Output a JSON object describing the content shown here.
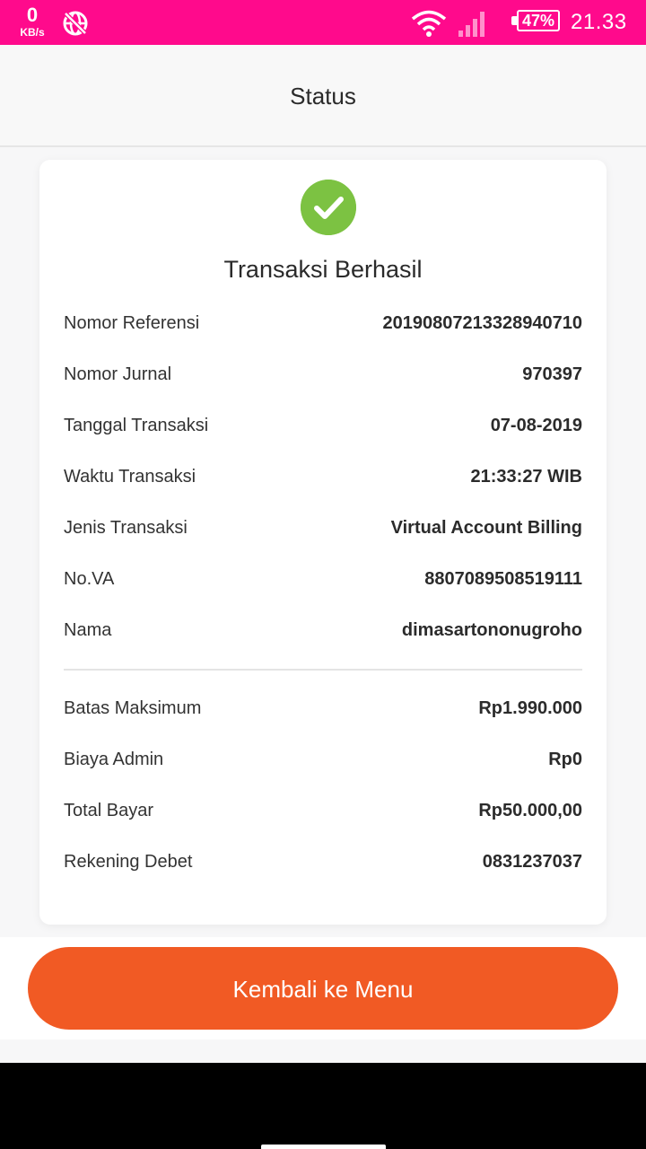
{
  "status_bar": {
    "speed_value": "0",
    "speed_unit": "KB/s",
    "battery": "47%",
    "time": "21.33",
    "icons": [
      "globe-off-icon",
      "wifi-icon",
      "signal-icon",
      "battery-icon"
    ]
  },
  "header": {
    "title": "Status"
  },
  "result": {
    "icon": "check-circle-icon",
    "title": "Transaksi Berhasil"
  },
  "details": [
    {
      "label": "Nomor Referensi",
      "value": "20190807213328940710"
    },
    {
      "label": "Nomor Jurnal",
      "value": "970397"
    },
    {
      "label": "Tanggal Transaksi",
      "value": "07-08-2019"
    },
    {
      "label": "Waktu Transaksi",
      "value": "21:33:27 WIB"
    },
    {
      "label": "Jenis Transaksi",
      "value": "Virtual Account Billing"
    },
    {
      "label": "No.VA",
      "value": "8807089508519111"
    },
    {
      "label": "Nama",
      "value": "dimasartononugroho"
    }
  ],
  "payment": [
    {
      "label": "Batas Maksimum",
      "value": "Rp1.990.000"
    },
    {
      "label": "Biaya Admin",
      "value": "Rp0"
    },
    {
      "label": "Total Bayar",
      "value": "Rp50.000,00"
    },
    {
      "label": "Rekening Debet",
      "value": "0831237037"
    }
  ],
  "actions": {
    "back_label": "Kembali ke Menu"
  },
  "colors": {
    "status_bar": "#ff0a8c",
    "success": "#7cc242",
    "primary_button": "#f15a24"
  }
}
